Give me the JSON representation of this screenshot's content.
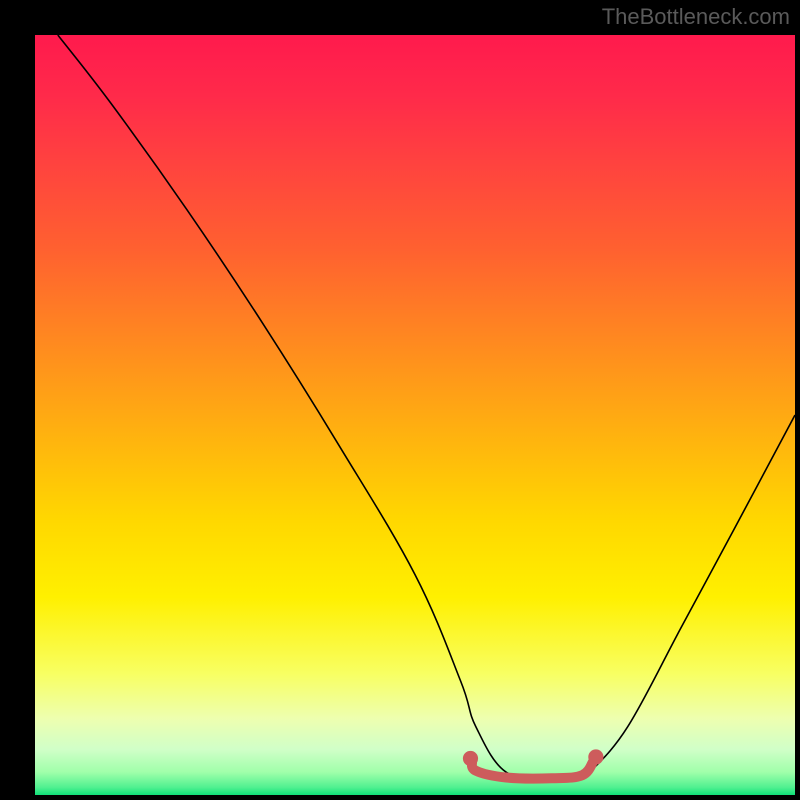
{
  "watermark": "TheBottleneck.com",
  "chart_data": {
    "type": "line",
    "title": "",
    "xlabel": "",
    "ylabel": "",
    "xlim": [
      0,
      100
    ],
    "ylim": [
      0,
      100
    ],
    "series": [
      {
        "name": "curve",
        "color": "#000000",
        "x": [
          3,
          10,
          20,
          30,
          40,
          50,
          56,
          58,
          62,
          68,
          72,
          73,
          78,
          85,
          92,
          100
        ],
        "y": [
          100,
          91,
          77,
          62,
          46,
          29,
          15,
          9,
          3,
          2.2,
          2.5,
          3,
          9,
          22,
          35,
          50
        ]
      },
      {
        "name": "highlight",
        "color": "#cd5c5c",
        "x": [
          57.5,
          58,
          62,
          68,
          72,
          73.5
        ],
        "y": [
          4.5,
          3.2,
          2.3,
          2.2,
          2.6,
          4.5
        ]
      }
    ],
    "markers": [
      {
        "name": "highlight-start-dot",
        "x": 57.3,
        "y": 4.8,
        "r": 1.0,
        "color": "#cd5c5c"
      },
      {
        "name": "highlight-end-dot",
        "x": 73.8,
        "y": 5.0,
        "r": 1.0,
        "color": "#cd5c5c"
      }
    ]
  }
}
